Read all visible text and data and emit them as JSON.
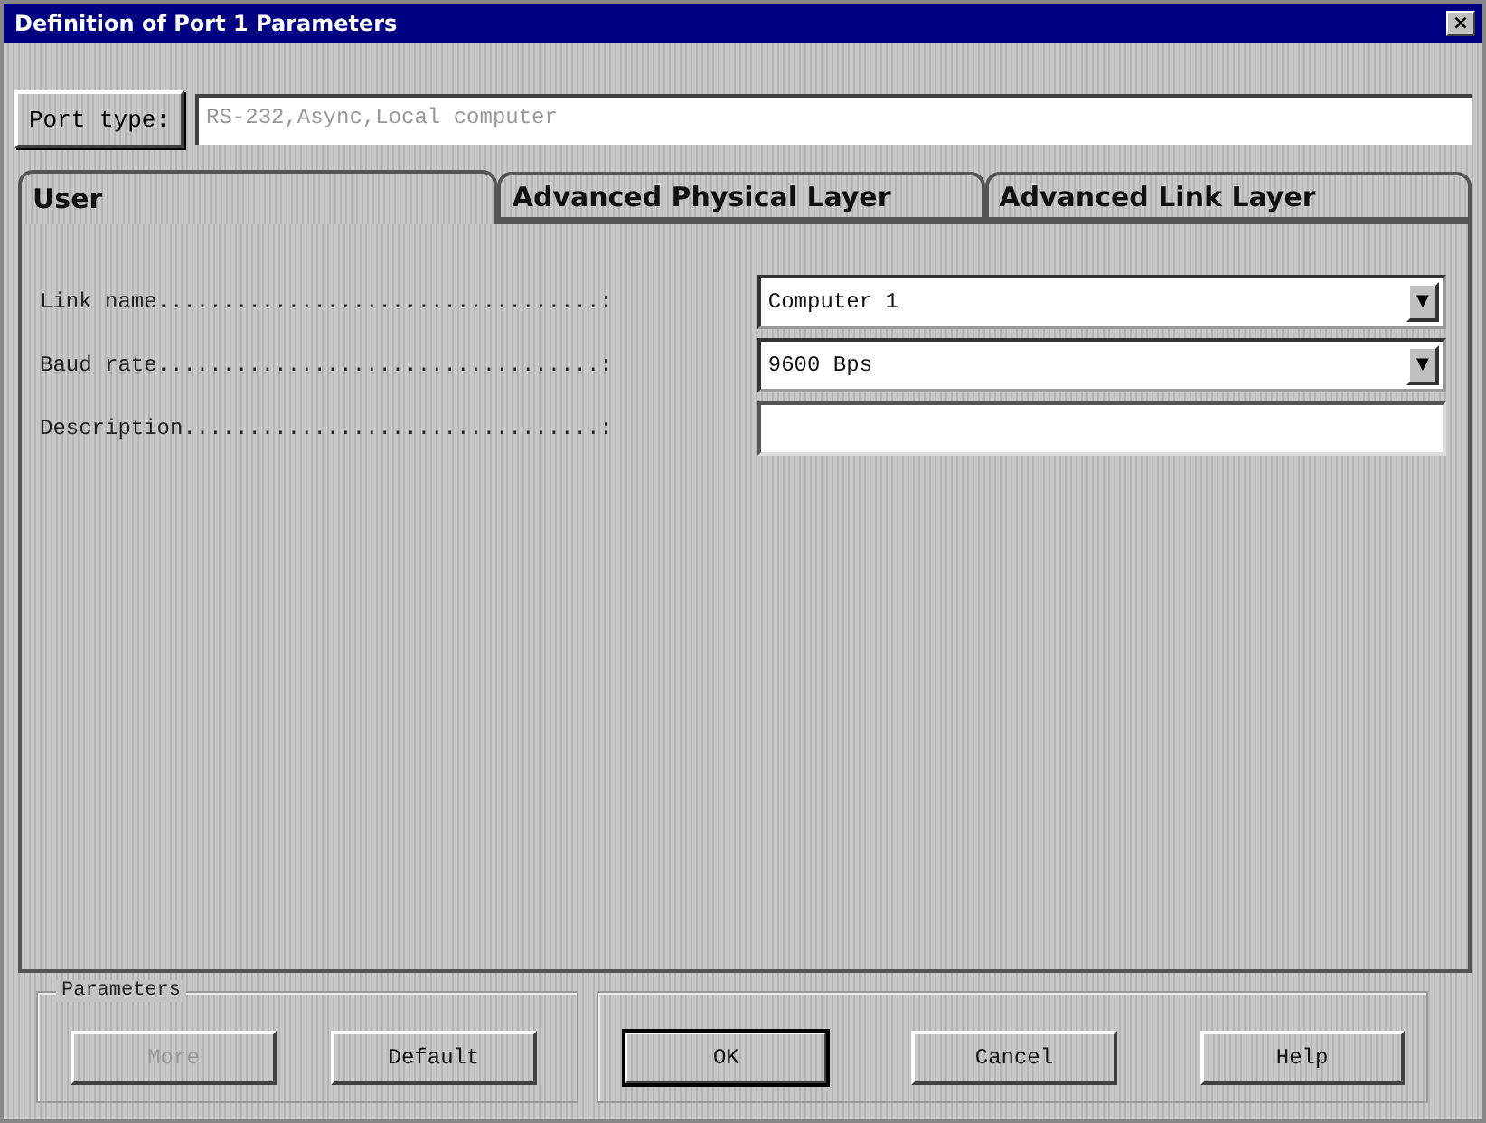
{
  "window": {
    "title": "Definition of  Port 1 Parameters",
    "close": "×"
  },
  "port_type": {
    "label": "Port type:",
    "value": "RS-232,Async,Local computer",
    "disabled": true
  },
  "tabs": [
    {
      "label": "User",
      "selected": true
    },
    {
      "label": "Advanced Physical Layer",
      "selected": false
    },
    {
      "label": "Advanced Link Layer",
      "selected": false
    }
  ],
  "fields": [
    {
      "label": "Link name..................................:",
      "kind": "dropdown",
      "value": "Computer 1",
      "arrow": "▼"
    },
    {
      "label": "Baud rate..................................:",
      "kind": "dropdown",
      "value": "9600  Bps",
      "arrow": "▼"
    },
    {
      "label": "Description................................:",
      "kind": "text"
    }
  ],
  "parameters_group": {
    "title": "Parameters",
    "buttons": [
      {
        "label": "More",
        "disabled": true,
        "default": false
      },
      {
        "label": "Default",
        "disabled": false,
        "default": false
      }
    ]
  },
  "buttons": [
    {
      "label": "OK",
      "disabled": false,
      "default": true
    },
    {
      "label": "Cancel",
      "disabled": false,
      "default": false
    },
    {
      "label": "Help",
      "disabled": false,
      "default": false
    }
  ]
}
